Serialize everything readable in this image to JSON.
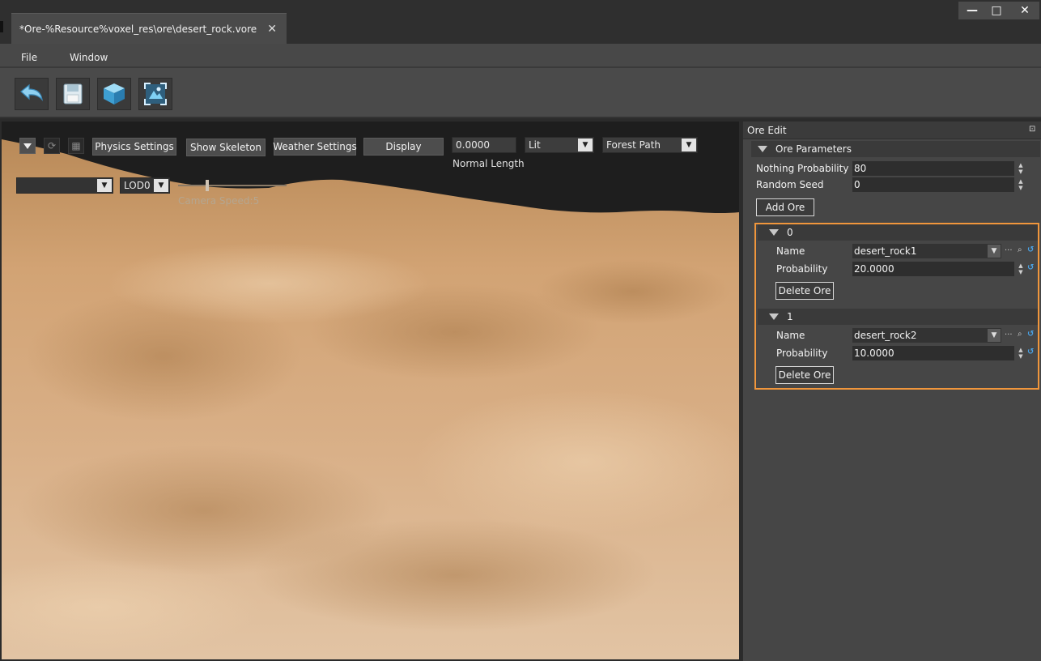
{
  "window": {
    "tab_title": "*Ore-%Resource%voxel_res\\ore\\desert_rock.vore",
    "minimize": "—",
    "maximize": "□",
    "close": "✕"
  },
  "menu": {
    "items": [
      "File",
      "Window"
    ]
  },
  "toolbar": {
    "tools": [
      "undo-icon",
      "save-icon",
      "cube-icon",
      "camera-focus-icon"
    ]
  },
  "viewport": {
    "physics_settings": "Physics Settings",
    "show_skeleton": "Show Skeleton",
    "weather_settings": "Weather Settings",
    "display": "Display",
    "normal_length_value": "0.0000",
    "normal_length_label": "Normal Length",
    "lighting_mode": "Lit",
    "environment": "Forest Path",
    "animation_select": "",
    "lod": "LOD0",
    "camera_speed": "Camera Speed:5",
    "camera_speed_value": 5
  },
  "panel": {
    "title": "Ore Edit",
    "ore_parameters": {
      "header": "Ore Parameters",
      "nothing_probability_label": "Nothing Probability",
      "nothing_probability_value": "80",
      "random_seed_label": "Random Seed",
      "random_seed_value": "0",
      "add_ore": "Add Ore"
    },
    "ores": [
      {
        "index": "0",
        "name_label": "Name",
        "name_value": "desert_rock1",
        "probability_label": "Probability",
        "probability_value": "20.0000",
        "delete_label": "Delete Ore"
      },
      {
        "index": "1",
        "name_label": "Name",
        "name_value": "desert_rock2",
        "probability_label": "Probability",
        "probability_value": "10.0000",
        "delete_label": "Delete Ore"
      }
    ]
  },
  "colors": {
    "highlight_border": "#f0963c",
    "sand": "#c8965e",
    "accent_blue": "#4aa3e6"
  }
}
